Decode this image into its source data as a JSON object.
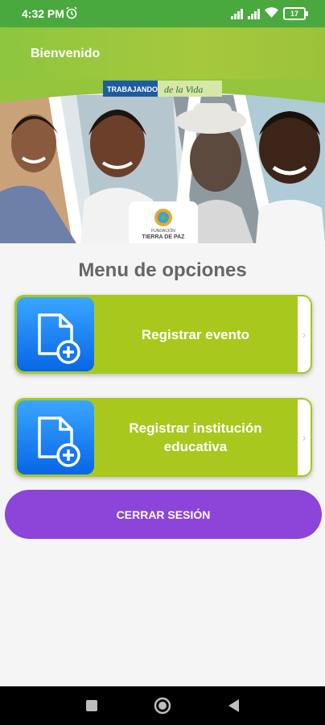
{
  "status_bar": {
    "time": "4:32 PM",
    "battery": "17"
  },
  "app_bar": {
    "title": "Bienvenido"
  },
  "banner": {
    "tag_line_1": "TRABAJANDO",
    "tag_line_2": "de la Vida",
    "logo_line_1": "FUNDACIÓN",
    "logo_line_2": "TIERRA DE PAZ"
  },
  "menu": {
    "title": "Menu de opciones",
    "items": [
      {
        "label": "Registrar evento"
      },
      {
        "label": "Registrar institución educativa"
      }
    ]
  },
  "logout_label": "CERRAR SESIÓN",
  "colors": {
    "status": "#4aa93e",
    "card": "#a8c81e",
    "icon_box": "#0b6fe8",
    "logout": "#8c44d9"
  },
  "icons": [
    "alarm-icon",
    "signal-icon",
    "wifi-icon",
    "battery-icon",
    "document-add-icon",
    "chevron-right-icon",
    "square-nav-icon",
    "circle-nav-icon",
    "back-nav-icon"
  ]
}
